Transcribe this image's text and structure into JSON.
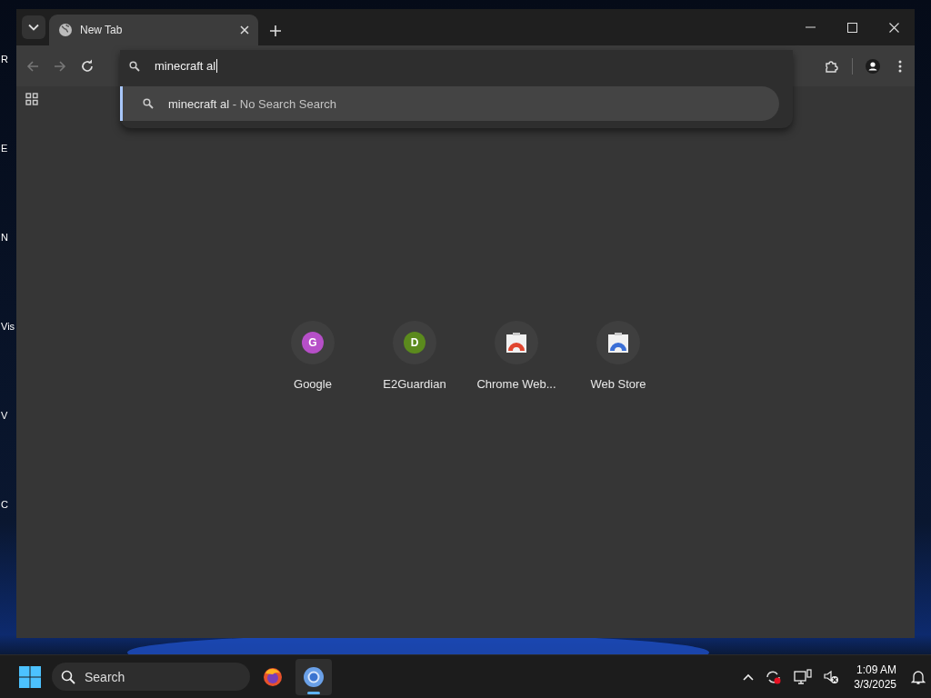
{
  "desktop_icons": [
    {
      "label": "R"
    },
    {
      "label": "E"
    },
    {
      "label": "N"
    },
    {
      "label": "Vis"
    },
    {
      "label": "V"
    },
    {
      "label": "C"
    }
  ],
  "browser": {
    "tabs": [
      {
        "title": "New Tab",
        "selected": true
      }
    ],
    "address": {
      "value": "minecraft al"
    },
    "suggestions": [
      {
        "query": "minecraft al",
        "separator": "-",
        "source": "No Search Search",
        "selected": true
      }
    ],
    "shortcuts": [
      {
        "label": "Google",
        "kind": "letter",
        "letter": "G",
        "color": "#b64fc8"
      },
      {
        "label": "E2Guardian",
        "kind": "letter",
        "letter": "D",
        "color": "#5b8a1d"
      },
      {
        "label": "Chrome Web...",
        "kind": "store",
        "color": "#e0452f"
      },
      {
        "label": "Web Store",
        "kind": "store",
        "color": "#3b6fd6"
      }
    ]
  },
  "taskbar": {
    "search": {
      "placeholder": "Search"
    },
    "apps": [
      {
        "kind": "firefox",
        "selected": false
      },
      {
        "kind": "chromium",
        "selected": true
      }
    ],
    "time": "1:09 AM",
    "date": "3/3/2025"
  }
}
